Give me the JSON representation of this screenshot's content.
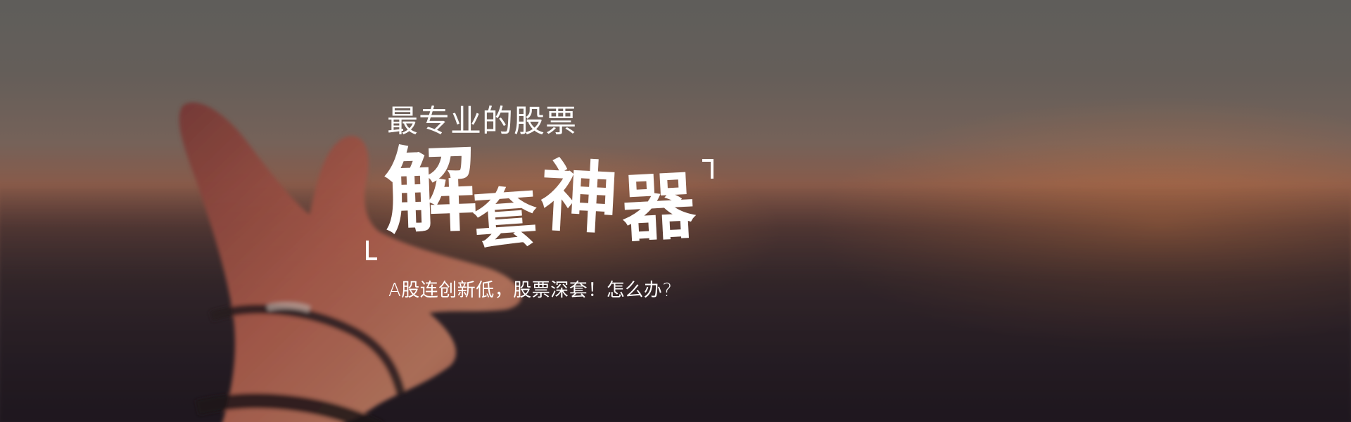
{
  "banner": {
    "subtitle": "最专业的股票",
    "headline_chars": [
      "解",
      "套",
      "神",
      "器"
    ],
    "tagline": "A股连创新低，股票深套！怎么办?"
  },
  "icons": {
    "corner_top_right": "corner-bracket-top-right",
    "corner_bottom_left": "corner-bracket-bottom-left"
  },
  "colors": {
    "text": "#ffffff",
    "sky": "#777068",
    "sunset": "#a26b55",
    "ground": "#2b232a"
  }
}
